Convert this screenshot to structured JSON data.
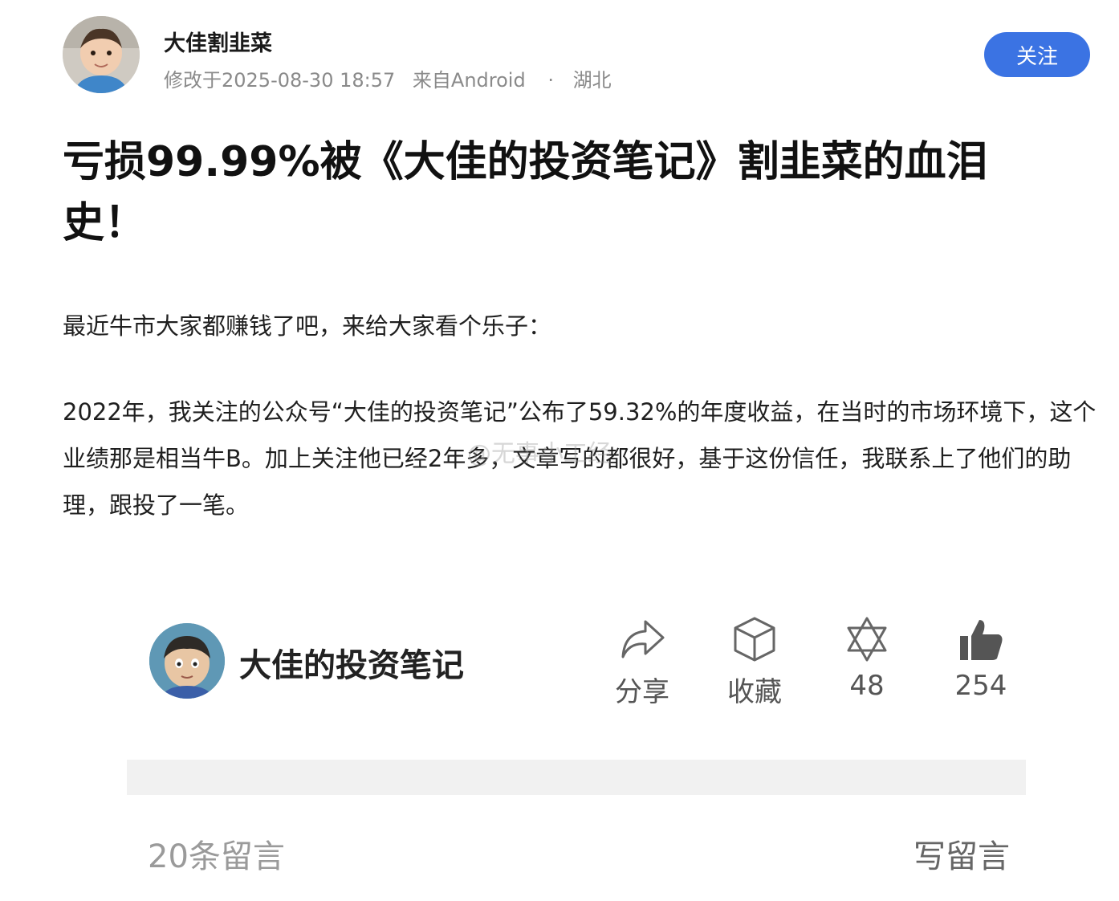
{
  "post": {
    "author": "大佳割韭菜",
    "modified": "修改于2025-08-30 18:57",
    "source": "来自Android",
    "separator": "·",
    "location": "湖北",
    "follow_label": "关注",
    "title": "亏损99.99%被《大佳的投资笔记》割韭菜的血泪史！",
    "paragraphs": [
      "最近牛市大家都赚钱了吧，来给大家看个乐子：",
      "2022年，我关注的公众号“大佳的投资笔记”公布了59.32%的年度收益，在当时的市场环境下，这个业绩那是相当牛B。加上关注他已经2年多，文章写的都很好，基于这份信任，我联系上了他们的助理，跟投了一笔。"
    ],
    "watermark": "@无事小工经"
  },
  "embed": {
    "account_name": "大佳的投资笔记",
    "actions": [
      {
        "label": "分享",
        "icon": "share-icon"
      },
      {
        "label": "收藏",
        "icon": "box-icon"
      },
      {
        "label": "48",
        "icon": "star-of-david-icon"
      },
      {
        "label": "254",
        "icon": "thumbs-up-icon"
      }
    ],
    "comments_count": "20条留言",
    "write_comment": "写留言"
  },
  "colors": {
    "follow_button": "#3b73e3",
    "meta_text": "#8a8a8a"
  }
}
